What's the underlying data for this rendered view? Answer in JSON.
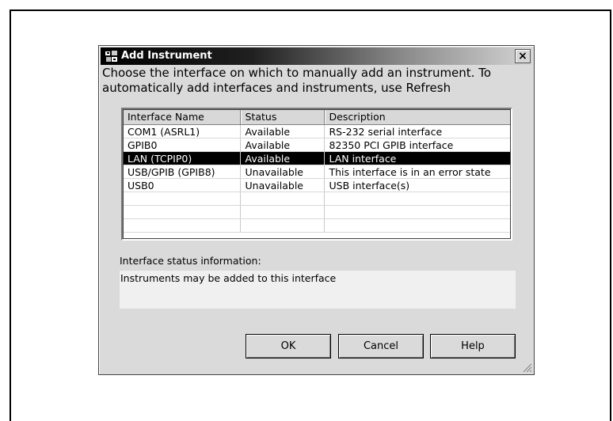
{
  "dialog": {
    "title": "Add Instrument",
    "close_glyph": "×",
    "instructions_line1": "Choose the interface on which to manually add an instrument.  To",
    "instructions_line2": "automatically add interfaces and instruments, use Refresh"
  },
  "table": {
    "columns": [
      "Interface Name",
      "Status",
      "Description"
    ],
    "rows": [
      {
        "name": "COM1 (ASRL1)",
        "status": "Available",
        "description": "RS-232 serial interface"
      },
      {
        "name": "GPIB0",
        "status": "Available",
        "description": "82350 PCI GPIB interface"
      },
      {
        "name": "LAN (TCPIP0)",
        "status": "Available",
        "description": "LAN interface"
      },
      {
        "name": "USB/GPIB (GPIB8)",
        "status": "Unavailable",
        "description": "This interface is in an error state"
      },
      {
        "name": "USB0",
        "status": "Unavailable",
        "description": "USB interface(s)"
      }
    ],
    "selected_row": 2
  },
  "status_info": {
    "label": "Interface status information:",
    "text": "Instruments may be added to this interface"
  },
  "buttons": {
    "ok": "OK",
    "cancel": "Cancel",
    "help": "Help"
  },
  "icons": {
    "title_icon": "instrument-icon",
    "resize_grip": "resize-grip-icon"
  },
  "colors": {
    "selected_row_bg": "#000000",
    "dialog_bg": "#dadada"
  }
}
